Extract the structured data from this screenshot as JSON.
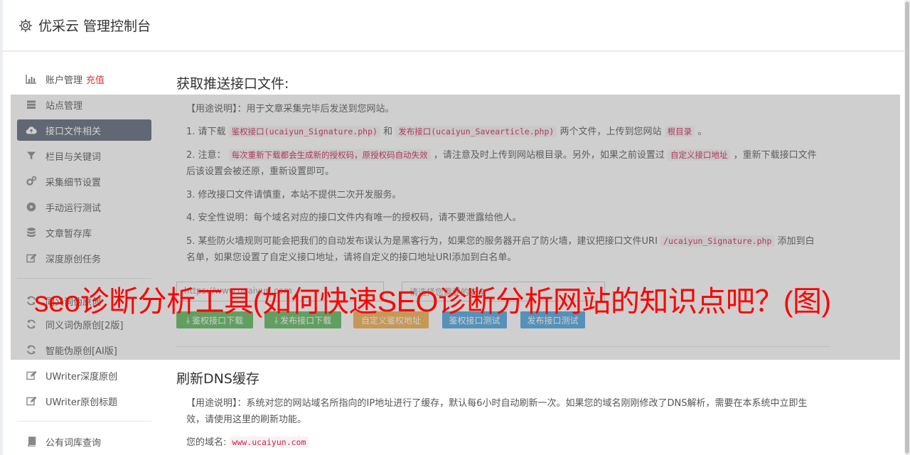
{
  "header": {
    "title": "优采云 管理控制台"
  },
  "sidebar": {
    "items": [
      {
        "label": "账户管理",
        "badge": "充值",
        "icon": "bar-chart-icon"
      },
      {
        "label": "站点管理",
        "icon": "list-icon"
      },
      {
        "label": "接口文件相关",
        "icon": "cloud-upload-icon"
      },
      {
        "label": "栏目与关键词",
        "icon": "filter-icon"
      },
      {
        "label": "采集细节设置",
        "icon": "cogs-icon"
      },
      {
        "label": "手动运行测试",
        "icon": "play-circle-icon"
      },
      {
        "label": "文章暂存库",
        "icon": "database-icon"
      },
      {
        "label": "深度原创任务",
        "icon": "edit-icon"
      },
      {
        "label": "同义词伪原创",
        "icon": "refresh-icon"
      },
      {
        "label": "同义词伪原创[2版]",
        "icon": "refresh-icon"
      },
      {
        "label": "智能伪原创[AI版]",
        "icon": "refresh-icon"
      },
      {
        "label": "UWriter深度原创",
        "icon": "edit-icon"
      },
      {
        "label": "UWriter原创标题",
        "icon": "edit-icon"
      },
      {
        "label": "公有词库查询",
        "icon": "book-icon"
      }
    ]
  },
  "section1": {
    "title": "获取推送接口文件:",
    "usage_label": "【用途说明】",
    "usage_text": "：用于文章采集完毕后发送到您网站。",
    "p1_prefix": "1. 请下载",
    "p1_code1": "鉴权接口(ucaiyun_Signature.php)",
    "p1_and": "和",
    "p1_code2": "发布接口(ucaiyun_Savearticle.php)",
    "p1_mid": "两个文件，上传到您网站",
    "p1_code3": "根目录",
    "p1_end": "。",
    "p2_prefix": "2. 注意：",
    "p2_code1": "每次重新下载都会生成新的授权码，原授权码自动失效",
    "p2_mid": "，请注意及时上传到网站根目录。另外，如果之前设置过",
    "p2_code2": "自定义接口地址",
    "p2_end": "，重新下载接口文件后该设置会被还原，重新设置即可。",
    "p3": "3. 修改接口文件请慎重，本站不提供二次开发服务。",
    "p4": "4. 安全性说明：每个域名对应的接口文件内有唯一的授权码，请不要泄露给他人。",
    "p5_prefix": "5. 某些防火墙规则可能会把我们的自动发布误认为是黑客行为，如果您的服务器开启了防火墙，建议把接口文件URI",
    "p5_code": "/ucaiyun_Signature.php",
    "p5_end": "添加到白名单，如果您设置了自定义接口地址，请将自定义的接口地址URI添加到白名单。",
    "url_placeholder": "https://www.ucaiyun.com",
    "second_placeholder": "请选择您需要的安全",
    "buttons": {
      "auth_download": "鉴权接口下载",
      "publish_download": "发布接口下载",
      "custom_auth": "自定义鉴权地址",
      "auth_test": "鉴权接口测试",
      "publish_test": "发布接口测试"
    }
  },
  "section2": {
    "title": "刷新DNS缓存",
    "usage_label": "【用途说明】",
    "usage_text": "：系统对您的网站域名所指向的IP地址进行了缓存，默认每6小时自动刷新一次。如果您的域名刚刚修改了DNS解析，需要在本系统中立即生效，请使用这里的刷新功能。",
    "domain_label": "您的域名:",
    "domain_value": "www.ucaiyun.com"
  },
  "watermark": "seo诊断分析工具(如何快速SEO诊断分析网站的知识点吧？(图)",
  "colors": {
    "accent_active": "#5b6676",
    "danger": "#d9363e",
    "code": "#c7254e",
    "green": "#5cb85c",
    "orange": "#f0ad4e",
    "blue": "#4aa3df"
  }
}
